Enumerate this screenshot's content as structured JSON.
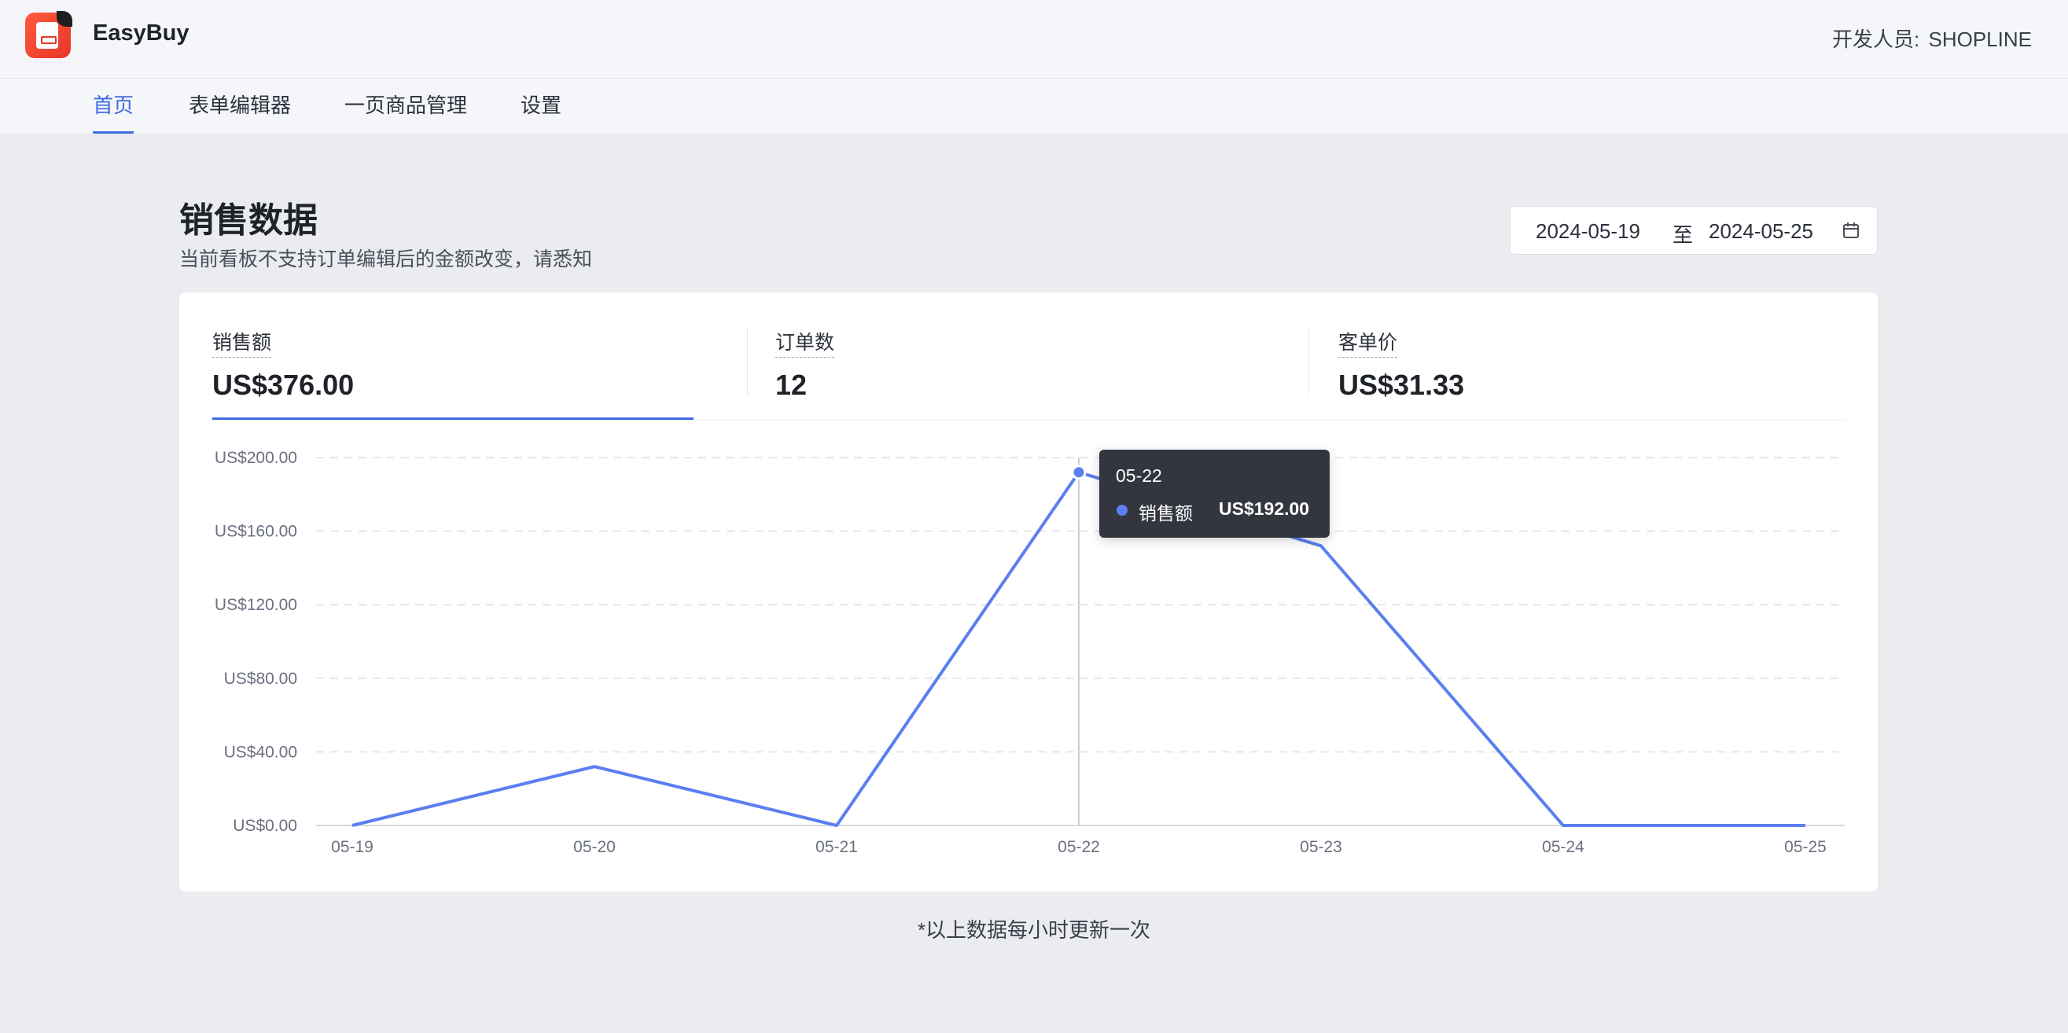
{
  "app": {
    "name": "EasyBuy",
    "developer_label": "开发人员:",
    "developer_value": "SHOPLINE"
  },
  "nav": {
    "tabs": [
      {
        "label": "首页",
        "active": true
      },
      {
        "label": "表单编辑器",
        "active": false
      },
      {
        "label": "一页商品管理",
        "active": false
      },
      {
        "label": "设置",
        "active": false
      }
    ]
  },
  "page": {
    "title": "销售数据",
    "subtitle": "当前看板不支持订单编辑后的金额改变，请悉知"
  },
  "date_range": {
    "start": "2024-05-19",
    "separator": "至",
    "end": "2024-05-25",
    "icon": "calendar-icon"
  },
  "metrics": [
    {
      "label": "销售额",
      "value": "US$376.00",
      "selected": true
    },
    {
      "label": "订单数",
      "value": "12",
      "selected": false
    },
    {
      "label": "客单价",
      "value": "US$31.33",
      "selected": false
    }
  ],
  "colors": {
    "accent": "#3e6bde",
    "line": "#5b7ff0",
    "background": "#ebecf0",
    "tooltip_bg": "#33363f"
  },
  "chart_data": {
    "type": "line",
    "categories": [
      "05-19",
      "05-20",
      "05-21",
      "05-22",
      "05-23",
      "05-24",
      "05-25"
    ],
    "series": [
      {
        "name": "销售额",
        "values": [
          0,
          32,
          0,
          192,
          152,
          0,
          0
        ]
      }
    ],
    "y_ticks": [
      "US$0.00",
      "US$40.00",
      "US$80.00",
      "US$120.00",
      "US$160.00",
      "US$200.00"
    ],
    "ylim": [
      0,
      200
    ],
    "grid": true,
    "tooltip": {
      "category": "05-22",
      "series": "销售额",
      "value": "US$192.00"
    }
  },
  "footnote": "*以上数据每小时更新一次"
}
